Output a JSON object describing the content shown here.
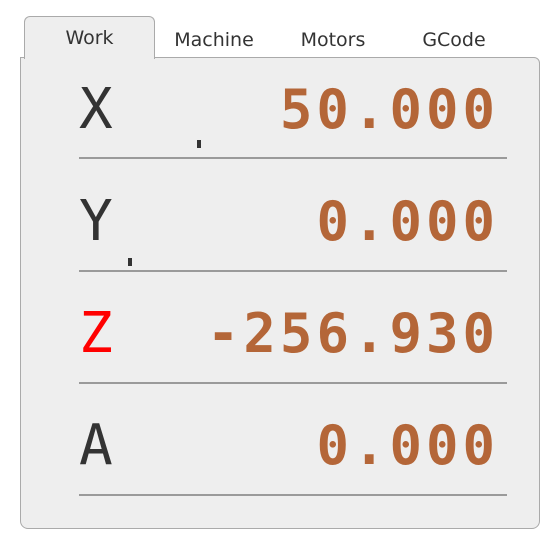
{
  "tabs": [
    {
      "label": "Work",
      "active": true
    },
    {
      "label": "Machine",
      "active": false
    },
    {
      "label": "Motors",
      "active": false
    },
    {
      "label": "GCode",
      "active": false
    }
  ],
  "axes": [
    {
      "label": "X",
      "value": "50.000"
    },
    {
      "label": "Y",
      "value": "0.000"
    },
    {
      "label": "Z",
      "value": "-256.930",
      "label_color": "#ff0000"
    },
    {
      "label": "A",
      "value": "0.000"
    }
  ],
  "colors": {
    "value_text": "#b46638",
    "label_text": "#333333",
    "alert_label": "#ff0000",
    "panel_background": "#eeeeee"
  }
}
